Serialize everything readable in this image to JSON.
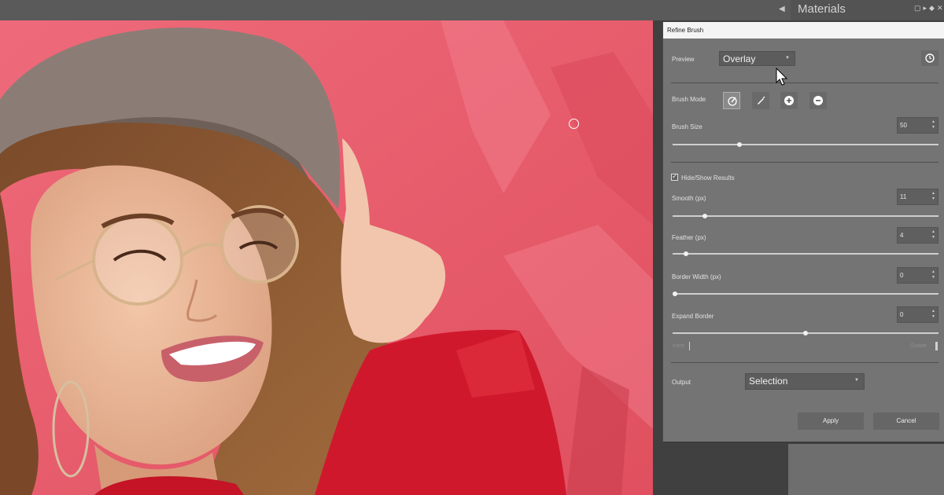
{
  "topbar": {
    "panel_title": "Materials"
  },
  "dialog": {
    "title": "Refine Brush",
    "preview": {
      "label": "Preview",
      "value": "Overlay"
    },
    "brush_mode": {
      "label": "Brush Mode"
    },
    "brush_size": {
      "label": "Brush Size",
      "value": "50",
      "fraction": 0.25
    },
    "hide_show": {
      "label": "Hide/Show Results",
      "checked": true
    },
    "smooth": {
      "label": "Smooth (px)",
      "value": "11",
      "fraction": 0.12
    },
    "feather": {
      "label": "Feather (px)",
      "value": "4",
      "fraction": 0.05
    },
    "border_width": {
      "label": "Border Width (px)",
      "value": "0",
      "fraction": 0.0
    },
    "expand_border": {
      "label": "Expand Border",
      "value": "0",
      "fraction": 0.5,
      "min_label": "Inset",
      "max_label": "Outset"
    },
    "output": {
      "label": "Output",
      "value": "Selection"
    },
    "apply_label": "Apply",
    "cancel_label": "Cancel"
  },
  "colors": {
    "backdrop": "#e85a6c",
    "dialog": "#747474",
    "sweater": "#d0182c"
  }
}
